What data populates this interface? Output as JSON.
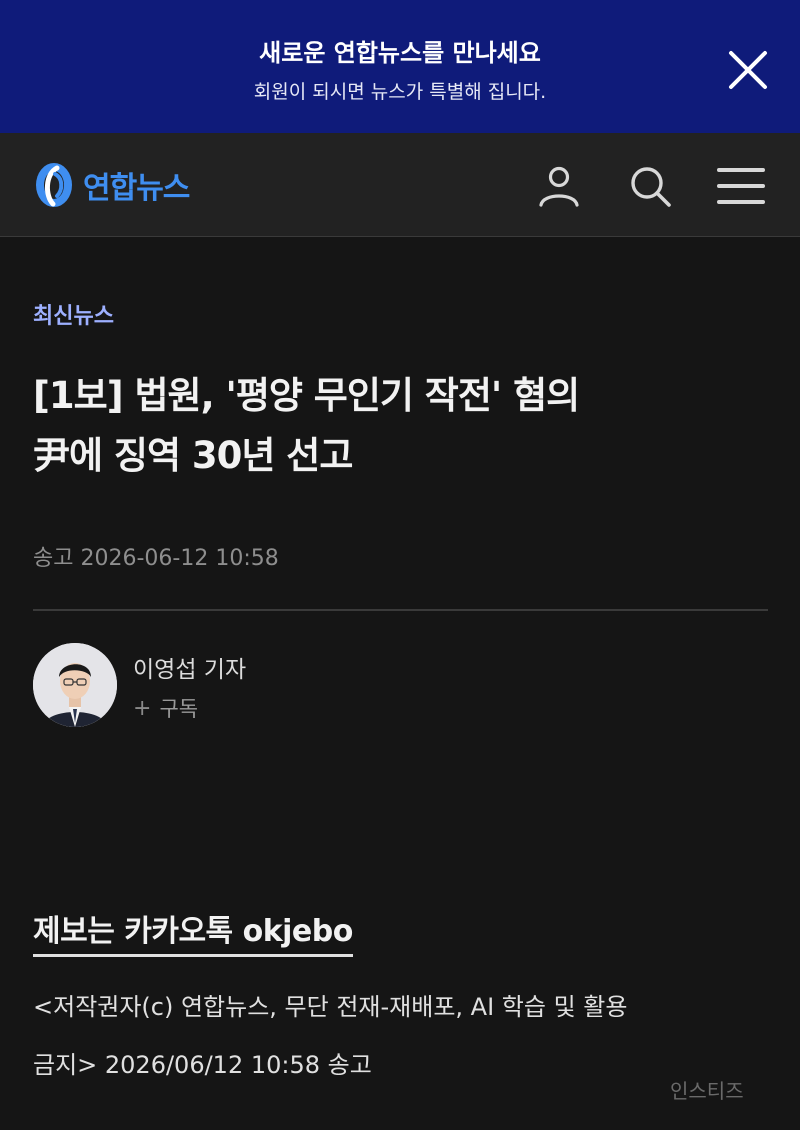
{
  "promo": {
    "title": "새로운 연합뉴스를 만나세요",
    "subtitle": "회원이 되시면 뉴스가 특별해 집니다.",
    "bg_color": "#0f1b7a"
  },
  "header": {
    "logo_text": "연합뉴스",
    "logo_color": "#3f8ef0",
    "icons": [
      "user-icon",
      "search-icon",
      "menu-icon"
    ]
  },
  "article": {
    "category": "최신뉴스",
    "headline_line1": "[1보] 법원, '평양 무인기 작전' 혐의",
    "headline_line2": "尹에 징역 30년 선고",
    "dateline": "송고 2026-06-12 10:58"
  },
  "reporter": {
    "name": "이영섭 기자",
    "subscribe_label": "구독",
    "subscribe_icon": "plus-icon"
  },
  "footer": {
    "tip": "제보는 카카오톡 okjebo",
    "copyright_line1": "<저작권자(c) 연합뉴스, 무단 전재-재배포, AI 학습 및 활용",
    "copyright_line2": "금지> 2026/06/12 10:58 송고"
  },
  "watermark": "인스티즈"
}
